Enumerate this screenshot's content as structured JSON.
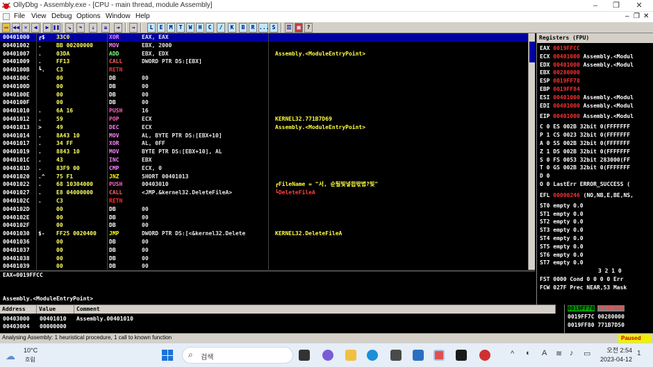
{
  "window": {
    "title": "OllyDbg - Assembly.exe - [CPU - main thread, module Assembly]",
    "controls": [
      "–",
      "❐",
      "✕"
    ]
  },
  "menu": [
    "File",
    "View",
    "Debug",
    "Options",
    "Window",
    "Help"
  ],
  "toolbar": {
    "buttons": [
      "L",
      "E",
      "M",
      "T",
      "W",
      "H",
      "C",
      "/",
      "K",
      "B",
      "R",
      "...",
      "S"
    ]
  },
  "disasm": [
    {
      "addr": "00401000",
      "mk": "┏$",
      "hex": "33C0",
      "mn": "XOR",
      "op": "EAX, EAX",
      "cm": "",
      "cls": "m-default"
    },
    {
      "addr": "00401002",
      "mk": ".",
      "hex": "BB 00200000",
      "mn": "MOV",
      "op": "EBX, 2000",
      "cm": "",
      "cls": "m-default"
    },
    {
      "addr": "00401007",
      "mk": ".",
      "hex": "03DA",
      "mn": "ADD",
      "op": "EBX, EDX",
      "cm": "Assembly.<ModuleEntryPoint>",
      "cls": "m-add"
    },
    {
      "addr": "00401009",
      "mk": ".",
      "hex": "FF13",
      "mn": "CALL",
      "op": "DWORD PTR DS:[EBX]",
      "cm": "",
      "cls": "m-call"
    },
    {
      "addr": "0040100B",
      "mk": "┗.",
      "hex": "C3",
      "mn": "RETN",
      "op": "",
      "cm": "",
      "cls": "m-retn"
    },
    {
      "addr": "0040100C",
      "mk": "",
      "hex": "00",
      "mn": "DB",
      "op": "00",
      "cm": "",
      "cls": "m-db"
    },
    {
      "addr": "0040100D",
      "mk": "",
      "hex": "00",
      "mn": "DB",
      "op": "00",
      "cm": "",
      "cls": "m-db"
    },
    {
      "addr": "0040100E",
      "mk": "",
      "hex": "00",
      "mn": "DB",
      "op": "00",
      "cm": "",
      "cls": "m-db"
    },
    {
      "addr": "0040100F",
      "mk": "",
      "hex": "00",
      "mn": "DB",
      "op": "00",
      "cm": "",
      "cls": "m-db"
    },
    {
      "addr": "00401010",
      "mk": ".",
      "hex": "6A 16",
      "mn": "PUSH",
      "op": "16",
      "cm": "",
      "cls": "m-push"
    },
    {
      "addr": "00401012",
      "mk": ".",
      "hex": "59",
      "mn": "POP",
      "op": "ECX",
      "cm": "KERNEL32.771B7D69",
      "cls": "m-push"
    },
    {
      "addr": "00401013",
      "mk": ">",
      "hex": "49",
      "mn": "DEC",
      "op": "ECX",
      "cm": "Assembly.<ModuleEntryPoint>",
      "cls": "m-default"
    },
    {
      "addr": "00401014",
      "mk": ".",
      "hex": "8A43 10",
      "mn": "MOV",
      "op": "AL, BYTE PTR DS:[EBX+10]",
      "cm": "",
      "cls": "m-default"
    },
    {
      "addr": "00401017",
      "mk": ".",
      "hex": "34 FF",
      "mn": "XOR",
      "op": "AL, 0FF",
      "cm": "",
      "cls": "m-default"
    },
    {
      "addr": "00401019",
      "mk": ".",
      "hex": "8843 10",
      "mn": "MOV",
      "op": "BYTE PTR DS:[EBX+10], AL",
      "cm": "",
      "cls": "m-default"
    },
    {
      "addr": "0040101C",
      "mk": ".",
      "hex": "43",
      "mn": "INC",
      "op": "EBX",
      "cm": "",
      "cls": "m-default"
    },
    {
      "addr": "0040101D",
      "mk": ".",
      "hex": "83F9 00",
      "mn": "CMP",
      "op": "ECX, 0",
      "cm": "",
      "cls": "m-default"
    },
    {
      "addr": "00401020",
      "mk": ".^",
      "hex": "75 F1",
      "mn": "JNZ",
      "op": "SHORT 00401013",
      "cm": "",
      "cls": "m-jmp"
    },
    {
      "addr": "00401022",
      "mk": ".",
      "hex": "68 10304000",
      "mn": "PUSH",
      "op": "00403010",
      "cm": "┏FileName = \"서, 순틸빛넣읩딳볍?빛\"",
      "cls": "m-push"
    },
    {
      "addr": "00401027",
      "mk": ".",
      "hex": "E8 04000000",
      "mn": "CALL",
      "op": "<JMP.&kernel32.DeleteFileA>",
      "cm": "┗DeleteFileA",
      "cls": "m-call"
    },
    {
      "addr": "0040102C",
      "mk": ".",
      "hex": "C3",
      "mn": "RETN",
      "op": "",
      "cm": "",
      "cls": "m-retn"
    },
    {
      "addr": "0040102D",
      "mk": "",
      "hex": "00",
      "mn": "DB",
      "op": "00",
      "cm": "",
      "cls": "m-db"
    },
    {
      "addr": "0040102E",
      "mk": "",
      "hex": "00",
      "mn": "DB",
      "op": "00",
      "cm": "",
      "cls": "m-db"
    },
    {
      "addr": "0040102F",
      "mk": "",
      "hex": "00",
      "mn": "DB",
      "op": "00",
      "cm": "",
      "cls": "m-db"
    },
    {
      "addr": "00401030",
      "mk": "$-",
      "hex": "FF25 0020400",
      "mn": "JMP",
      "op": "DWORD PTR DS:[<&kernel32.Delete",
      "cm": "KERNEL32.DeleteFileA",
      "cls": "m-jmp"
    },
    {
      "addr": "00401036",
      "mk": "",
      "hex": "00",
      "mn": "DB",
      "op": "00",
      "cm": "",
      "cls": "m-db"
    },
    {
      "addr": "00401037",
      "mk": "",
      "hex": "00",
      "mn": "DB",
      "op": "00",
      "cm": "",
      "cls": "m-db"
    },
    {
      "addr": "00401038",
      "mk": "",
      "hex": "00",
      "mn": "DB",
      "op": "00",
      "cm": "",
      "cls": "m-db"
    },
    {
      "addr": "00401039",
      "mk": "",
      "hex": "00",
      "mn": "DB",
      "op": "00",
      "cm": "",
      "cls": "m-db"
    }
  ],
  "info": {
    "line1": "EAX=0019FFCC",
    "line2": "Assembly.<ModuleEntryPoint>"
  },
  "dump": {
    "headers": [
      "Address",
      "Value",
      "Comment"
    ],
    "rows": [
      [
        "00403000",
        "00401010",
        "Assembly.00401010"
      ],
      [
        "00403004",
        "00000000",
        ""
      ]
    ]
  },
  "registers": {
    "title": "Registers (FPU)",
    "gp": [
      [
        "EAX",
        "0019FFCC",
        ""
      ],
      [
        "ECX",
        "00401000",
        "Assembly.<Modul"
      ],
      [
        "EDX",
        "00401000",
        "Assembly.<Modul"
      ],
      [
        "EBX",
        "00280000",
        ""
      ],
      [
        "ESP",
        "0019FF78",
        ""
      ],
      [
        "EBP",
        "0019FF84",
        ""
      ],
      [
        "ESI",
        "00401000",
        "Assembly.<Modul"
      ],
      [
        "EDI",
        "00401000",
        "Assembly.<Modul"
      ]
    ],
    "eip": [
      "EIP",
      "00401000",
      "Assembly.<Modul"
    ],
    "flags": [
      "C 0  ES 002B 32bit 0(FFFFFFF",
      "P 1  CS 0023 32bit 0(FFFFFFF",
      "A 0  SS 002B 32bit 0(FFFFFFF",
      "Z 1  DS 002B 32bit 0(FFFFFFF",
      "S 0  FS 0053 32bit 283000(FF",
      "T 0  GS 002B 32bit 0(FFFFFFF",
      "D 0",
      "O 0  LastErr ERROR_SUCCESS ("
    ],
    "efl": [
      "EFL",
      "00000246",
      "(NO,NB,E,BE,NS,"
    ],
    "fpu": [
      "ST0 empty 0.0",
      "ST1 empty 0.0",
      "ST2 empty 0.0",
      "ST3 empty 0.0",
      "ST4 empty 0.0",
      "ST5 empty 0.0",
      "ST6 empty 0.0",
      "ST7 empty 0.0"
    ],
    "fpubits": "3 2 1 0",
    "fst": "FST 0000  Cond 0 0 0 0  Err",
    "fcw": "FCW 027F  Prec NEAR,53  Mask"
  },
  "stack": [
    [
      "0019FF78",
      "771B7D69"
    ],
    [
      "0019FF7C",
      "00280000"
    ],
    [
      "0019FF80",
      "771B7D50"
    ]
  ],
  "status": {
    "text": "Analysing Assembly: 1 heuristical procedure, 1 call to known function",
    "state": "Paused"
  },
  "taskbar": {
    "temp": "10°C",
    "cond": "흐림",
    "search": "검색",
    "time": "오전 2:54",
    "date": "2023-04-12",
    "lang": "A"
  }
}
